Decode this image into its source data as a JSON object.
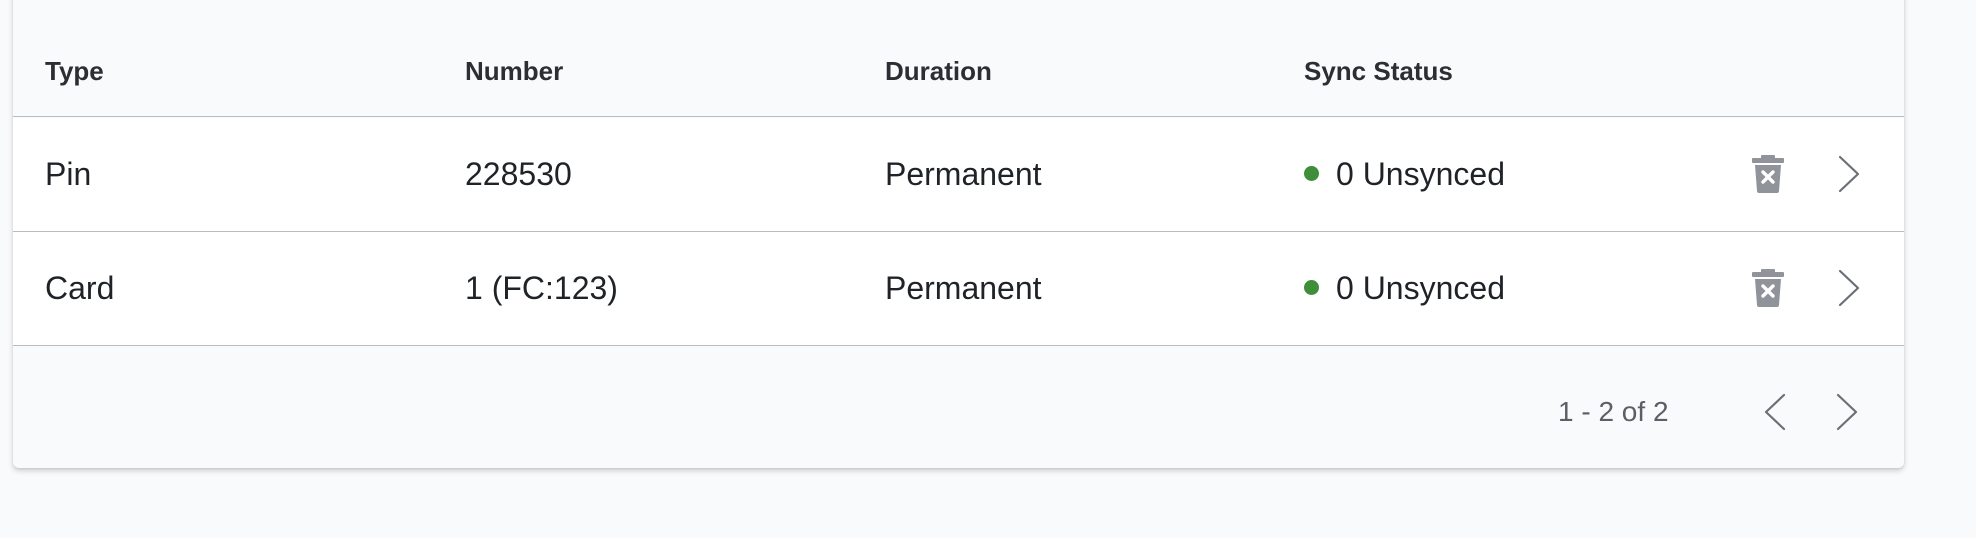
{
  "table": {
    "columns": {
      "type": "Type",
      "number": "Number",
      "duration": "Duration",
      "sync_status": "Sync Status"
    },
    "rows": [
      {
        "type": "Pin",
        "number": "228530",
        "duration": "Permanent",
        "sync_status": "0 Unsynced",
        "status_color": "#3f8f3a",
        "delete_icon": "trash-x-icon",
        "open_icon": "chevron-right-icon"
      },
      {
        "type": "Card",
        "number": "1 (FC:123)",
        "duration": "Permanent",
        "sync_status": "0 Unsynced",
        "status_color": "#3f8f3a",
        "delete_icon": "trash-x-icon",
        "open_icon": "chevron-right-icon"
      }
    ]
  },
  "pagination": {
    "range_text": "1 - 2 of 2",
    "prev_icon": "chevron-left-icon",
    "next_icon": "chevron-right-icon"
  },
  "colors": {
    "background": "#f9fafc",
    "row_background": "#ffffff",
    "divider": "#b9bcc3",
    "status_green": "#3f8f3a",
    "icon_gray": "#909399"
  }
}
